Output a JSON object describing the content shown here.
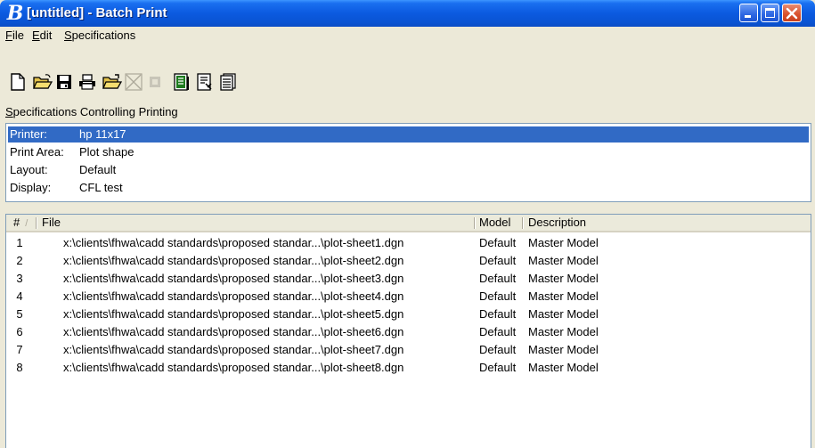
{
  "window": {
    "title": "[untitled] - Batch Print",
    "app_icon_glyph": "B",
    "minimize_icon": "minimize-icon",
    "maximize_icon": "maximize-icon",
    "close_icon": "close-icon"
  },
  "menu": {
    "file": "File",
    "edit": "Edit",
    "specifications": "Specifications"
  },
  "toolbar": {
    "icons": [
      "new-file-icon",
      "open-folder-icon",
      "save-icon",
      "print-icon",
      "open-specification-icon",
      "delete-icon",
      "disabled-placeholder-icon",
      "printer-setup-icon",
      "page-setup-icon",
      "print-all-icon"
    ]
  },
  "specs": {
    "label": "Specifications Controlling Printing",
    "rows": [
      {
        "key": "Printer:",
        "value": "hp 11x17"
      },
      {
        "key": "Print Area:",
        "value": "Plot shape"
      },
      {
        "key": "Layout:",
        "value": "Default"
      },
      {
        "key": "Display:",
        "value": "CFL test"
      }
    ]
  },
  "file_list": {
    "columns": {
      "num": "#",
      "file": "File",
      "model": "Model",
      "description": "Description"
    },
    "rows": [
      {
        "num": "1",
        "file": "x:\\clients\\fhwa\\cadd standards\\proposed standar...\\plot-sheet1.dgn",
        "model": "Default",
        "description": "Master Model"
      },
      {
        "num": "2",
        "file": "x:\\clients\\fhwa\\cadd standards\\proposed standar...\\plot-sheet2.dgn",
        "model": "Default",
        "description": "Master Model"
      },
      {
        "num": "3",
        "file": "x:\\clients\\fhwa\\cadd standards\\proposed standar...\\plot-sheet3.dgn",
        "model": "Default",
        "description": "Master Model"
      },
      {
        "num": "4",
        "file": "x:\\clients\\fhwa\\cadd standards\\proposed standar...\\plot-sheet4.dgn",
        "model": "Default",
        "description": "Master Model"
      },
      {
        "num": "5",
        "file": "x:\\clients\\fhwa\\cadd standards\\proposed standar...\\plot-sheet5.dgn",
        "model": "Default",
        "description": "Master Model"
      },
      {
        "num": "6",
        "file": "x:\\clients\\fhwa\\cadd standards\\proposed standar...\\plot-sheet6.dgn",
        "model": "Default",
        "description": "Master Model"
      },
      {
        "num": "7",
        "file": "x:\\clients\\fhwa\\cadd standards\\proposed standar...\\plot-sheet7.dgn",
        "model": "Default",
        "description": "Master Model"
      },
      {
        "num": "8",
        "file": "x:\\clients\\fhwa\\cadd standards\\proposed standar...\\plot-sheet8.dgn",
        "model": "Default",
        "description": "Master Model"
      }
    ]
  },
  "colors": {
    "titlebar": "#0b5ae0",
    "selection": "#316ac5",
    "face": "#ece9d8"
  }
}
